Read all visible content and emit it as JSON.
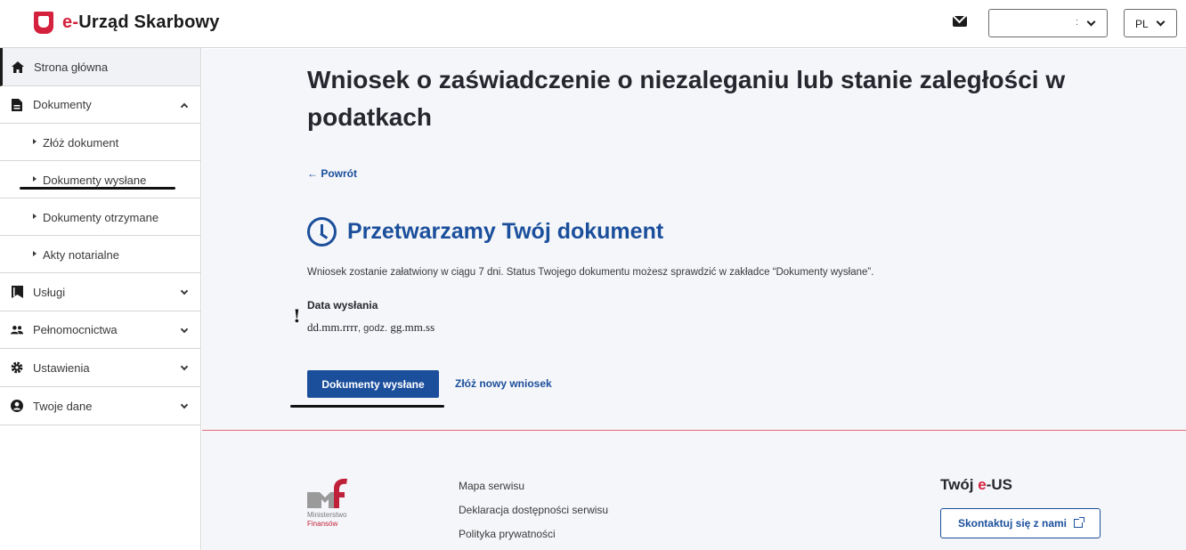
{
  "header": {
    "logo_prefix": "e-",
    "logo_name": "Urząd Skarbowy",
    "account_value": ":",
    "language": "PL"
  },
  "sidebar": {
    "items": [
      {
        "label": "Strona główna",
        "icon": "home-icon"
      },
      {
        "label": "Dokumenty",
        "icon": "document-icon"
      },
      {
        "label": "Usługi",
        "icon": "bookmark-icon"
      },
      {
        "label": "Pełnomocnictwa",
        "icon": "people-icon"
      },
      {
        "label": "Ustawienia",
        "icon": "gear-icon"
      },
      {
        "label": "Twoje dane",
        "icon": "user-circle-icon"
      }
    ],
    "sub_items": [
      {
        "label": "Złóż dokument"
      },
      {
        "label": "Dokumenty wysłane"
      },
      {
        "label": "Dokumenty otrzymane"
      },
      {
        "label": "Akty notarialne"
      }
    ]
  },
  "main": {
    "title": "Wniosek o zaświadczenie o niezaleganiu lub stanie zaległości w podatkach",
    "back_link": "← Powrót",
    "status_heading": "Przetwarzamy Twój dokument",
    "info_text": "Wniosek zostanie załatwiony w ciągu 7 dni. Status Twojego dokumentu możesz sprawdzić w zakładce “Dokumenty wysłane”.",
    "exclamation": "!",
    "date_label": "Data wysłania",
    "date_value": "dd.mm.rrrr",
    "date_sep": ", godz.",
    "time_value": "gg.mm.ss",
    "primary_button": "Dokumenty wysłane",
    "secondary_link": "Złóż nowy wniosek"
  },
  "footer": {
    "logo_line1": "Ministerstwo",
    "logo_line2": "Finansów",
    "links": [
      "Mapa serwisu",
      "Deklaracja dostępności serwisu",
      "Polityka prywatności"
    ],
    "eus_prefix": "Twój ",
    "eus_e": "e",
    "eus_suffix": "-US",
    "contact_button": "Skontaktuj się z nami"
  },
  "colors": {
    "brand_red": "#d4213d",
    "primary_blue": "#1b4f9c"
  }
}
